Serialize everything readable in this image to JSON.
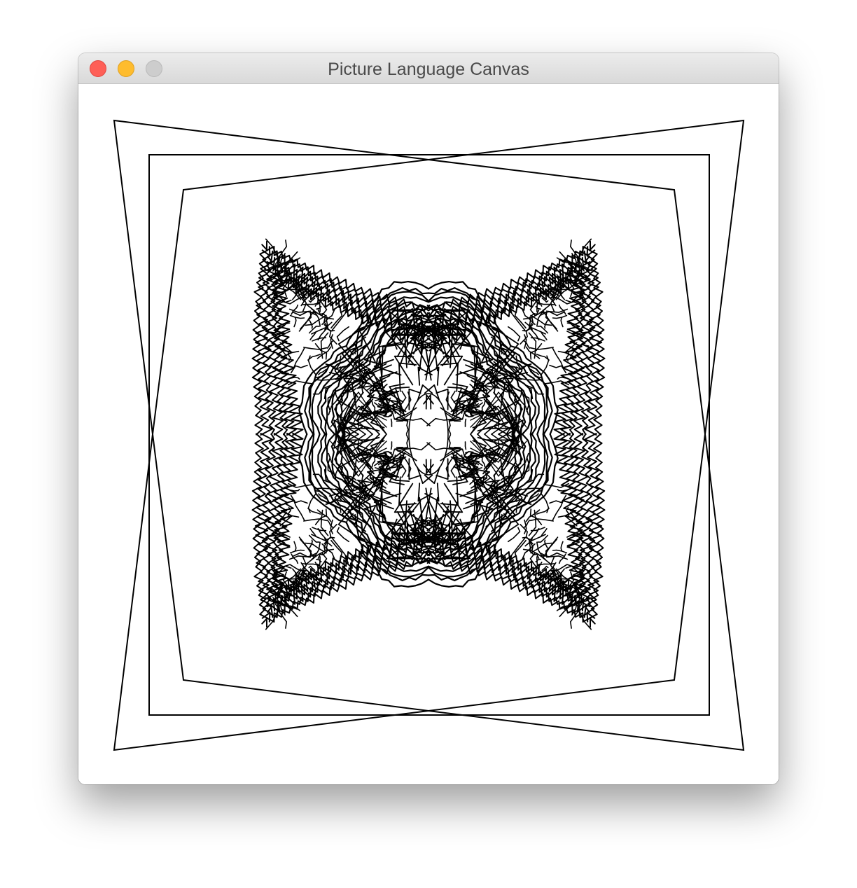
{
  "window": {
    "title": "Picture Language Canvas"
  },
  "colors": {
    "close": "#fe5f57",
    "minimize": "#febc2e",
    "zoom": "#cdcdcd",
    "stroke": "#000000",
    "background": "#ffffff"
  },
  "icons": {
    "close": "close-icon",
    "minimize": "minimize-icon",
    "zoom": "zoom-icon"
  }
}
